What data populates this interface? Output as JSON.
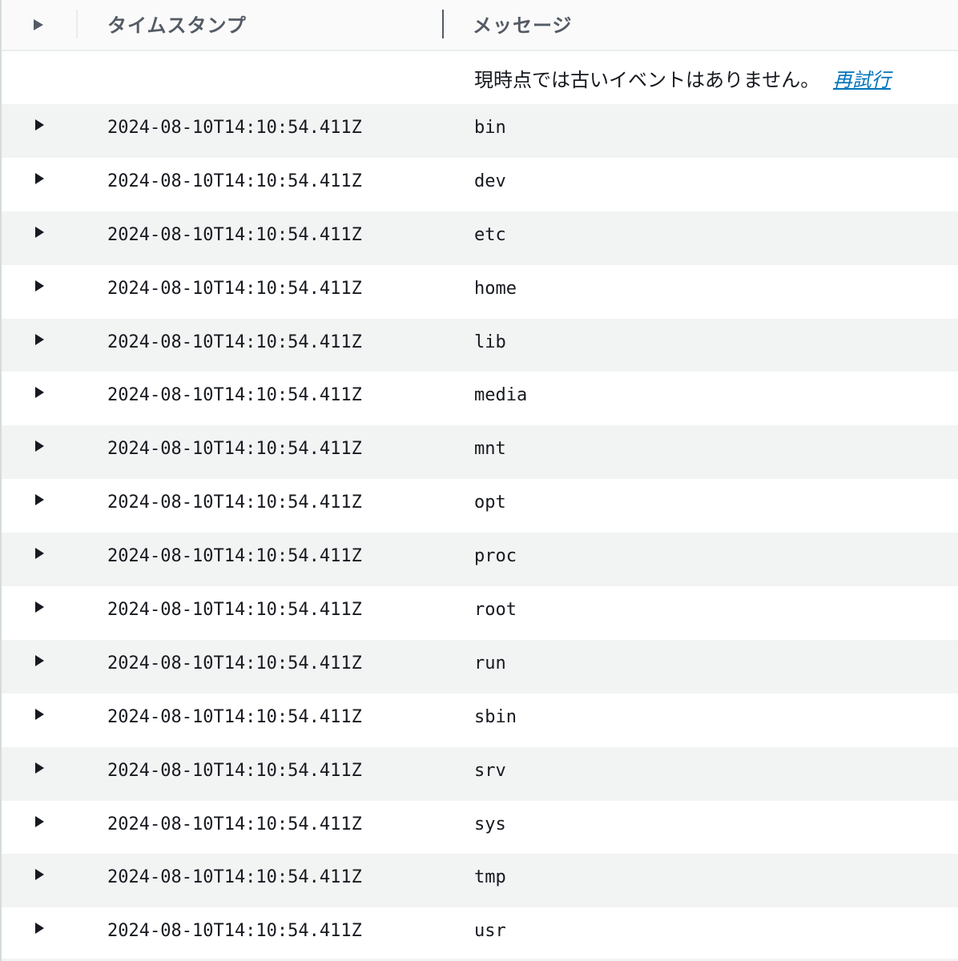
{
  "header": {
    "timestamp_label": "タイムスタンプ",
    "message_label": "メッセージ"
  },
  "notice": {
    "text": "現時点では古いイベントはありません。",
    "retry_label": "再試行"
  },
  "rows": [
    {
      "timestamp": "2024-08-10T14:10:54.411Z",
      "message": "bin"
    },
    {
      "timestamp": "2024-08-10T14:10:54.411Z",
      "message": "dev"
    },
    {
      "timestamp": "2024-08-10T14:10:54.411Z",
      "message": "etc"
    },
    {
      "timestamp": "2024-08-10T14:10:54.411Z",
      "message": "home"
    },
    {
      "timestamp": "2024-08-10T14:10:54.411Z",
      "message": "lib"
    },
    {
      "timestamp": "2024-08-10T14:10:54.411Z",
      "message": "media"
    },
    {
      "timestamp": "2024-08-10T14:10:54.411Z",
      "message": "mnt"
    },
    {
      "timestamp": "2024-08-10T14:10:54.411Z",
      "message": "opt"
    },
    {
      "timestamp": "2024-08-10T14:10:54.411Z",
      "message": "proc"
    },
    {
      "timestamp": "2024-08-10T14:10:54.411Z",
      "message": "root"
    },
    {
      "timestamp": "2024-08-10T14:10:54.411Z",
      "message": "run"
    },
    {
      "timestamp": "2024-08-10T14:10:54.411Z",
      "message": "sbin"
    },
    {
      "timestamp": "2024-08-10T14:10:54.411Z",
      "message": "srv"
    },
    {
      "timestamp": "2024-08-10T14:10:54.411Z",
      "message": "sys"
    },
    {
      "timestamp": "2024-08-10T14:10:54.411Z",
      "message": "tmp"
    },
    {
      "timestamp": "2024-08-10T14:10:54.411Z",
      "message": "usr"
    }
  ],
  "icons": {
    "expand": "caret-right-icon"
  },
  "colors": {
    "link": "#0073bb",
    "header_text": "#545b64",
    "row_shade": "#f2f3f3",
    "text": "#16191f"
  }
}
